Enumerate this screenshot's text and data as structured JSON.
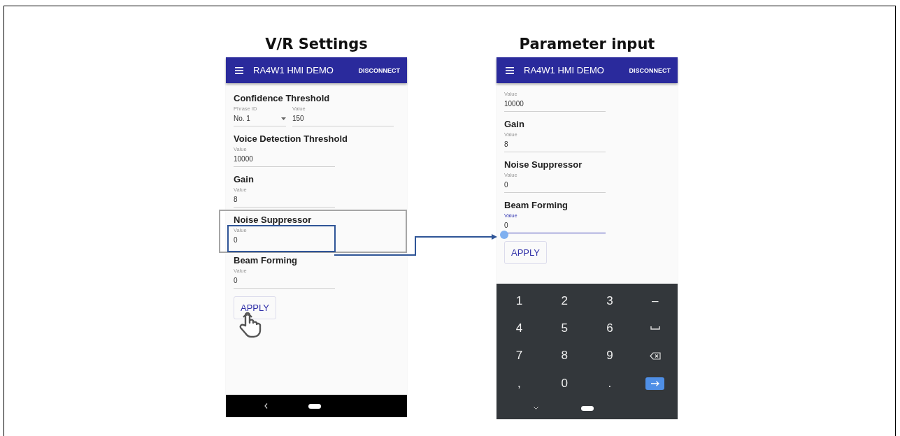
{
  "panels": [
    {
      "caption": "V/R Settings",
      "app_bar": {
        "title": "RA4W1 HMI DEMO",
        "action": "DISCONNECT"
      },
      "sections": [
        {
          "heading": "Confidence Threshold",
          "highlighted": false,
          "fields": [
            {
              "kind": "dropdown",
              "label": "Phrase ID",
              "value": "No. 1",
              "focused": false,
              "highlighted": false
            },
            {
              "kind": "text",
              "label": "Value",
              "value": "150",
              "focused": false,
              "highlighted": false
            }
          ]
        },
        {
          "heading": "Voice Detection Threshold",
          "highlighted": false,
          "fields": [
            {
              "kind": "text",
              "label": "Value",
              "value": "10000",
              "focused": false,
              "highlighted": false
            }
          ]
        },
        {
          "heading": "Gain",
          "highlighted": false,
          "fields": [
            {
              "kind": "text",
              "label": "Value",
              "value": "8",
              "focused": false,
              "highlighted": false
            }
          ]
        },
        {
          "heading": "Noise Suppressor",
          "highlighted": true,
          "fields": [
            {
              "kind": "text",
              "label": "Value",
              "value": "0",
              "focused": false,
              "highlighted": true
            }
          ]
        },
        {
          "heading": "Beam Forming",
          "highlighted": false,
          "fields": [
            {
              "kind": "text",
              "label": "Value",
              "value": "0",
              "focused": false,
              "highlighted": false
            }
          ]
        }
      ],
      "apply_button": {
        "label": "APPLY",
        "tapped": true
      },
      "kind": "nav_bar"
    },
    {
      "caption": "Parameter input",
      "app_bar": {
        "title": "RA4W1 HMI DEMO",
        "action": "DISCONNECT"
      },
      "sections": [
        {
          "highlighted": false,
          "fields": [
            {
              "kind": "text",
              "label": "Value",
              "value": "10000",
              "focused": false,
              "highlighted": false
            }
          ]
        },
        {
          "heading": "Gain",
          "highlighted": false,
          "fields": [
            {
              "kind": "text",
              "label": "Value",
              "value": "8",
              "focused": false,
              "highlighted": false
            }
          ]
        },
        {
          "heading": "Noise Suppressor",
          "highlighted": false,
          "fields": [
            {
              "kind": "text",
              "label": "Value",
              "value": "0",
              "focused": false,
              "highlighted": false
            }
          ]
        },
        {
          "heading": "Beam Forming",
          "highlighted": false,
          "fields": [
            {
              "kind": "text",
              "label": "Value",
              "value": "0",
              "focused": true,
              "highlighted": false
            }
          ]
        }
      ],
      "apply_button": {
        "label": "APPLY",
        "tapped": false
      },
      "kind": "keyboard",
      "keyboard": [
        [
          {
            "kind": "char",
            "label": "1"
          },
          {
            "kind": "char",
            "label": "2"
          },
          {
            "kind": "char",
            "label": "3"
          },
          {
            "kind": "char",
            "label": "–"
          }
        ],
        [
          {
            "kind": "char",
            "label": "4"
          },
          {
            "kind": "char",
            "label": "5"
          },
          {
            "kind": "char",
            "label": "6"
          },
          {
            "kind": "space"
          }
        ],
        [
          {
            "kind": "char",
            "label": "7"
          },
          {
            "kind": "char",
            "label": "8"
          },
          {
            "kind": "char",
            "label": "9"
          },
          {
            "kind": "backspace"
          }
        ],
        [
          {
            "kind": "char",
            "label": ","
          },
          {
            "kind": "char",
            "label": "0"
          },
          {
            "kind": "char",
            "label": "."
          },
          {
            "kind": "enter"
          }
        ]
      ]
    }
  ]
}
